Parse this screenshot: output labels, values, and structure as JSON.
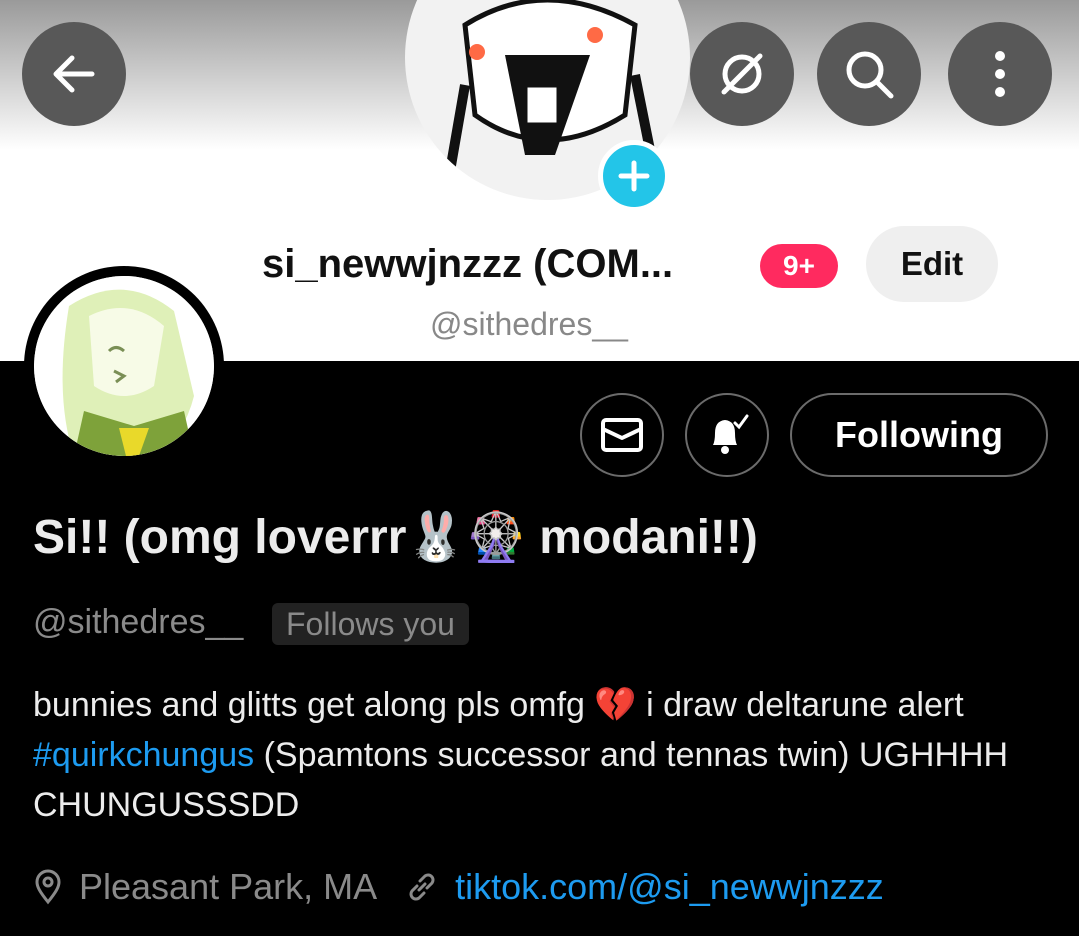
{
  "header": {
    "back_icon": "arrow-left-icon",
    "action_icons": [
      "eye-slash-icon",
      "search-icon",
      "more-vertical-icon"
    ],
    "top_name": "si_newwjnzzz (COM...",
    "notification_badge": "9+",
    "edit_label": "Edit",
    "top_handle": "@sithedres__",
    "accent": "#23c5e8",
    "badge_color": "#ff2a5f"
  },
  "profile": {
    "message_icon": "envelope-icon",
    "notify_icon": "bell-check-icon",
    "following_label": "Following",
    "display_name": "Si!! (omg loverrr🐰🎡 modani!!)",
    "handle": "@sithedres__",
    "follows_you": "Follows you",
    "bio_part1": "bunnies and glitts get along pls omfg 💔 i draw deltarune alert ",
    "bio_hashtag": "#quirkchungus",
    "bio_part2": " (Spamtons successor and tennas twin) UGHHHH CHUNGUSSSDD",
    "location": "Pleasant Park, MA",
    "link": "tiktok.com/@si_newwjnzzz",
    "link_color": "#1d9bf0"
  }
}
